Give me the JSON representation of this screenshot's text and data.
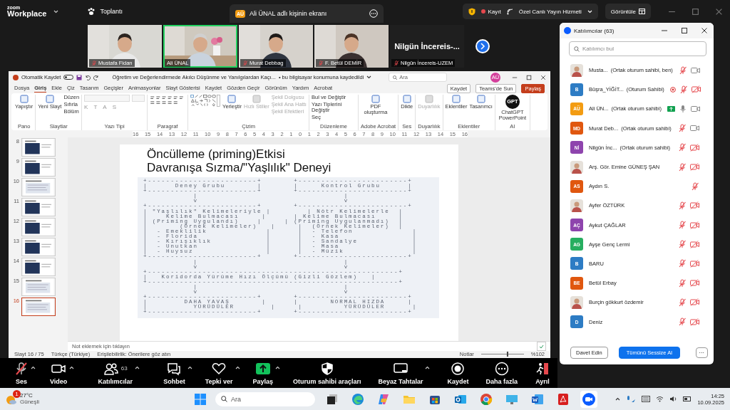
{
  "top_bar": {
    "brand": [
      "zoom",
      "Workplace"
    ],
    "meeting": "Toplantı",
    "share_banner": {
      "initials": "AÜ",
      "text": "Ali ÜNAL adlı kişinin ekranı"
    },
    "recording": "Kayıt",
    "stream": "Özel Canlı Yayın Hizmeti",
    "view": "Görüntüle"
  },
  "video_strip": {
    "tiles": [
      {
        "kind": "video",
        "name": "Mustafa Fidan",
        "muted": true,
        "selected": false
      },
      {
        "kind": "video",
        "name": "Ali ÜNAL",
        "muted": false,
        "selected": true
      },
      {
        "kind": "video",
        "name": "Murat Debbag",
        "muted": true,
        "selected": false
      },
      {
        "kind": "video",
        "name": "F. Betül DEMİR",
        "muted": true,
        "selected": false
      },
      {
        "kind": "name",
        "display": "Nilgün İncereis-...",
        "name": "Nilgün İncereis-UZEM",
        "muted": true,
        "selected": false
      }
    ]
  },
  "powerpoint": {
    "autosave": "Otomatik Kaydet",
    "autosave_on": false,
    "doc_title": "Öğretim ve Değerlendirmede Akılcı Düşünme ve Yanılgılardan Kaçı...",
    "save_status": "• bu bilgisayar konumuna kaydedildi",
    "search_placeholder": "Ara",
    "user_initials": "AÜ",
    "tabs": [
      {
        "label": "Dosya",
        "selected": false
      },
      {
        "label": "Giriş",
        "selected": true
      },
      {
        "label": "Ekle",
        "selected": false
      },
      {
        "label": "Çiz",
        "selected": false
      },
      {
        "label": "Tasarım",
        "selected": false
      },
      {
        "label": "Geçişler",
        "selected": false
      },
      {
        "label": "Animasyonlar",
        "selected": false
      },
      {
        "label": "Slayt Gösterisi",
        "selected": false
      },
      {
        "label": "Kaydet",
        "selected": false
      },
      {
        "label": "Gözden Geçir",
        "selected": false
      },
      {
        "label": "Görünüm",
        "selected": false
      },
      {
        "label": "Yardım",
        "selected": false
      },
      {
        "label": "Acrobat",
        "selected": false
      }
    ],
    "actions": [
      {
        "label": "Kaydet",
        "kind": "plain"
      },
      {
        "label": "Teams'de Sun",
        "kind": "plain"
      },
      {
        "label": "Paylaş",
        "kind": "primary"
      }
    ],
    "ribbon_groups": [
      {
        "label": "Pano",
        "kind": "buttons",
        "big": [
          {
            "label": "Yapıştır",
            "disabled": false
          }
        ]
      },
      {
        "label": "Slaytlar",
        "kind": "buttons",
        "big": [
          {
            "label": "Yeni Slayt",
            "disabled": false
          }
        ],
        "small": [
          {
            "label": "Düzen",
            "disabled": false
          },
          {
            "label": "Sıfırla",
            "disabled": false
          },
          {
            "label": "Bölüm",
            "disabled": false
          }
        ]
      },
      {
        "label": "Yazı Tipi",
        "kind": "font",
        "letters": [
          "K",
          "T",
          "A",
          "S"
        ]
      },
      {
        "label": "Paragraf",
        "kind": "paragraph"
      },
      {
        "label": "Çizim",
        "kind": "drawing",
        "big": [
          {
            "label": "Yerleştir",
            "disabled": false
          },
          {
            "label": "Hızlı Stiller",
            "disabled": true
          }
        ],
        "small": [
          {
            "label": "Şekil Dolgusu",
            "disabled": true
          },
          {
            "label": "Şekil Ana Hattı",
            "disabled": true
          },
          {
            "label": "Şekil Efektleri",
            "disabled": true
          }
        ]
      },
      {
        "label": "Düzenleme",
        "kind": "buttons",
        "small": [
          {
            "label": "Bul ve Değiştir",
            "disabled": false
          },
          {
            "label": "Yazı Tiplerini Değiştir",
            "disabled": false
          },
          {
            "label": "Seç",
            "disabled": false
          }
        ]
      },
      {
        "label": "Adobe Acrobat",
        "kind": "buttons",
        "big": [
          {
            "label": "PDF oluşturma",
            "disabled": false
          }
        ]
      },
      {
        "label": "Ses",
        "kind": "buttons",
        "big": [
          {
            "label": "Dikte",
            "disabled": false
          }
        ]
      },
      {
        "label": "Duyarlılık",
        "kind": "buttons",
        "big": [
          {
            "label": "Duyarlılık",
            "disabled": true
          }
        ]
      },
      {
        "label": "Eklentiler",
        "kind": "buttons",
        "big": [
          {
            "label": "Eklentiler",
            "disabled": false
          },
          {
            "label": "Tasarımcı",
            "disabled": false
          }
        ]
      },
      {
        "label": "AI",
        "kind": "gpt",
        "badge": "GPT",
        "big": [
          {
            "label": "ChatGPT PowerPoint",
            "disabled": false
          }
        ]
      }
    ],
    "ruler": [
      "16",
      "15",
      "14",
      "13",
      "12",
      "11",
      "10",
      "9",
      "8",
      "7",
      "6",
      "5",
      "4",
      "3",
      "2",
      "1",
      "0",
      "1",
      "2",
      "3",
      "4",
      "5",
      "6",
      "7",
      "8",
      "9",
      "10",
      "11",
      "12",
      "13",
      "14",
      "15",
      "16"
    ],
    "thumbnails": [
      {
        "number": "8",
        "selected": false
      },
      {
        "number": "9",
        "selected": false
      },
      {
        "number": "10",
        "kind": "text",
        "selected": false
      },
      {
        "number": "11",
        "selected": false
      },
      {
        "number": "12",
        "selected": false
      },
      {
        "number": "13",
        "selected": false
      },
      {
        "number": "14",
        "selected": false
      },
      {
        "number": "15",
        "kind": "text",
        "selected": false
      },
      {
        "number": "16",
        "kind": "text",
        "selected": true
      }
    ],
    "slide": {
      "title_lines": [
        "Öncülleme (priming)Etkisi",
        "Davranışa Sızma/\"Yaşlılık\" Deneyi"
      ],
      "diagram_lines": [
        "+------------------------+       +------------------------+",
        "|      Deney Grubu       |       |     Kontrol Grubu      |",
        "+------------------------+       +------------------------+",
        "           |                                |",
        "           v                                v",
        "+------------------------+       +------------------------+",
        "| \"Yaşlılık\" Kelimeleriyle |        | Nötr Kelimelerle  |",
        "|    Kelime Bulmacası     |      | Kelime Bulmacası     |",
        "| (Priming Uygulandı)    |     | (Priming Uygulanmadı)  |",
        "|       (Örnek Kelimeler)   |     |  (Örnek Kelimeler)  |",
        "|  - Emeklilik             |      |  - Telefon             |",
        "|  - Florida               |      |  - Kasa                |",
        "|  - Kırışıklık            |      |  - Sandalye            |",
        "|  - Unutkan               |      |  - Masa                |",
        "|  - Huysuz                |      |  - Müzik               |",
        "+------------------------+       +------------------------+",
        "           |                                |",
        "           v                                v",
        "+-------------------------------------------------------+",
        "|   Koridorda Yürüme Hızı Ölçümü (Gizli Gözlem)   |",
        "+-------------------------------------------------------+",
        "           |                                |",
        "           v                                v",
        "+------------------------+       +------------------------+",
        "|        DAHA YAVAŞ       |      |       NORMAL HIZDA     |",
        "|          YÜRÜDÜLER        |     |         YÜRÜDÜLER      |",
        "+------------------------+       +------------------------+"
      ]
    },
    "notes_placeholder": "Not eklemek için tıklayın",
    "status": {
      "slide": "Slayt 16 / 75",
      "language": "Türkçe (Türkiye)",
      "accessibility": "Erişilebilirlik: Önerilere göz atın",
      "notes": "Notlar",
      "zoom_slider": {
        "level": 0.62
      },
      "zoom": "%102"
    }
  },
  "participants": {
    "title": "Katılımcılar (63)",
    "search_placeholder": "Katılımcı bul",
    "rows": [
      {
        "kind": "video",
        "name": "Musta...",
        "role": "(Ortak oturum sahibi, ben)",
        "recording": false,
        "sharing": false,
        "muted": true,
        "video_off": false
      },
      {
        "kind": "video",
        "initials": "B",
        "color": "#2d7cc4",
        "name": "Büşra_YİĞİT...",
        "role": "(Oturum Sahibi)",
        "recording": true,
        "sharing": false,
        "muted": true,
        "video_off": true
      },
      {
        "kind": "video",
        "initials": "AÜ",
        "color": "#f39c12",
        "name": "Ali ÜN...",
        "role": "(Ortak oturum sahibi)",
        "recording": false,
        "sharing": true,
        "muted": false,
        "video_off": false
      },
      {
        "kind": "video",
        "initials": "MD",
        "color": "#e0570f",
        "name": "Murat Deb...",
        "role": "(Ortak oturum sahibi)",
        "recording": false,
        "sharing": false,
        "muted": true,
        "video_off": false
      },
      {
        "kind": "video",
        "initials": "Nİ",
        "color": "#8e44ad",
        "name": "Nilgün İnc...",
        "role": "(Ortak oturum sahibi)",
        "recording": false,
        "sharing": false,
        "muted": true,
        "video_off": true
      },
      {
        "kind": "video",
        "name": "Arş. Gör. Emine GÜNEŞ ŞAN",
        "recording": false,
        "sharing": false,
        "muted": true,
        "video_off": true
      },
      {
        "kind": "audio",
        "initials": "AS",
        "color": "#e0570f",
        "name": "Aydın S.",
        "recording": false,
        "sharing": false,
        "muted": true
      },
      {
        "kind": "video",
        "name": "Ayfer ÖZTÜRK",
        "recording": false,
        "sharing": false,
        "muted": true,
        "video_off": true
      },
      {
        "kind": "video",
        "initials": "AÇ",
        "color": "#8e44ad",
        "name": "Aykut ÇAĞLAR",
        "recording": false,
        "sharing": false,
        "muted": true,
        "video_off": true
      },
      {
        "kind": "video",
        "initials": "AG",
        "color": "#27ae60",
        "name": "Ayşe Genç Lermi",
        "recording": false,
        "sharing": false,
        "muted": true,
        "video_off": true
      },
      {
        "kind": "video",
        "initials": "B",
        "color": "#2d7cc4",
        "name": "BARU",
        "recording": false,
        "sharing": false,
        "muted": true,
        "video_off": true
      },
      {
        "kind": "video",
        "initials": "BE",
        "color": "#e0570f",
        "name": "Betül Erbay",
        "recording": false,
        "sharing": false,
        "muted": true,
        "video_off": true
      },
      {
        "kind": "video",
        "name": "Burçin gökkurt özdemir",
        "recording": false,
        "sharing": false,
        "muted": true,
        "video_off": true
      },
      {
        "kind": "video",
        "initials": "D",
        "color": "#2d7cc4",
        "name": "Deniz",
        "recording": false,
        "sharing": false,
        "muted": true,
        "video_off": true
      }
    ],
    "invite": "Davet Edin",
    "mute_all": "Tümünü Sessize Al",
    "more": "···"
  },
  "toolbar": [
    {
      "kind": "mic",
      "label": "Ses",
      "muted": true,
      "caret": true
    },
    {
      "kind": "camera",
      "label": "Video",
      "caret": true
    },
    {
      "kind": "people",
      "label": "Katılımcılar",
      "count": "63",
      "caret": true
    },
    {
      "kind": "chat",
      "label": "Sohbet",
      "caret": true
    },
    {
      "kind": "heart",
      "label": "Tepki ver",
      "caret": true
    },
    {
      "kind": "share",
      "label": "Paylaş",
      "caret": true
    },
    {
      "kind": "shield",
      "label": "Oturum sahibi araçları",
      "caret": false
    },
    {
      "kind": "whiteboard",
      "label": "Beyaz Tahtalar",
      "caret": true
    },
    {
      "kind": "record",
      "label": "Kaydet",
      "caret": false
    },
    {
      "kind": "more",
      "label": "Daha fazla",
      "caret": false
    },
    {
      "kind": "leave",
      "label": "Ayrıl",
      "caret": false
    }
  ],
  "taskbar": {
    "weather": {
      "temp": "27°C",
      "text": "Güneşli",
      "badge": "1"
    },
    "search_placeholder": "Ara",
    "apps": [
      {
        "kind": "taskview",
        "selected": false
      },
      {
        "kind": "edge",
        "selected": false
      },
      {
        "kind": "copilot",
        "selected": false
      },
      {
        "kind": "folder",
        "selected": false
      },
      {
        "kind": "store",
        "selected": false
      },
      {
        "kind": "outlook",
        "selected": false
      },
      {
        "kind": "chrome",
        "selected": false
      },
      {
        "kind": "monitor",
        "selected": false
      },
      {
        "kind": "word",
        "selected": false
      },
      {
        "kind": "acrobat",
        "selected": false
      },
      {
        "kind": "zoom",
        "selected": true
      }
    ],
    "time": "14:25",
    "date": "10.09.2025"
  }
}
